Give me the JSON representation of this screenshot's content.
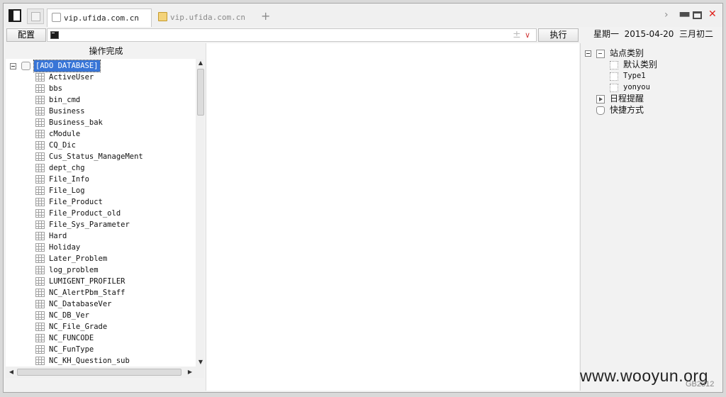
{
  "tabs": [
    {
      "label": "vip.ufida.com.cn",
      "active": true,
      "icon": "page-icon"
    },
    {
      "label": "vip.ufida.com.cn",
      "active": false,
      "icon": "folder-icon"
    }
  ],
  "new_tab_symbol": "+",
  "window_controls": {
    "chevron": "›",
    "minimize": "▬",
    "close": "✕"
  },
  "toolbar": {
    "config_label": "配置",
    "run_label": "执行",
    "address_value": "",
    "plus_symbol": "±",
    "dropdown_symbol": "∨",
    "date_text": "星期一  2015-04-20  三月初二"
  },
  "left_panel": {
    "status_text": "操作完成",
    "root_label": "[ADO DATABASE]",
    "tables": [
      "ActiveUser",
      "bbs",
      "bin_cmd",
      "Business",
      "Business_bak",
      "cModule",
      "CQ_Dic",
      "Cus_Status_ManageMent",
      "dept_chg",
      "File_Info",
      "File_Log",
      "File_Product",
      "File_Product_old",
      "File_Sys_Parameter",
      "Hard",
      "Holiday",
      "Later_Problem",
      "log_problem",
      "LUMIGENT_PROFILER",
      "NC_AlertPbm_Staff",
      "NC_DatabaseVer",
      "NC_DB_Ver",
      "NC_File_Grade",
      "NC_FUNCODE",
      "NC_FunType",
      "NC_KH_Question_sub"
    ],
    "scroll_symbols": {
      "up": "▲",
      "down": "▼",
      "left": "◀",
      "right": "▶"
    }
  },
  "right_panel": {
    "site_category": "站点类别",
    "children": [
      "默认类别",
      "Type1",
      "yonyou"
    ],
    "schedule": "日程提醒",
    "shortcuts": "快捷方式"
  },
  "watermark": "www.wooyun.org",
  "corner_text": "GB2312"
}
